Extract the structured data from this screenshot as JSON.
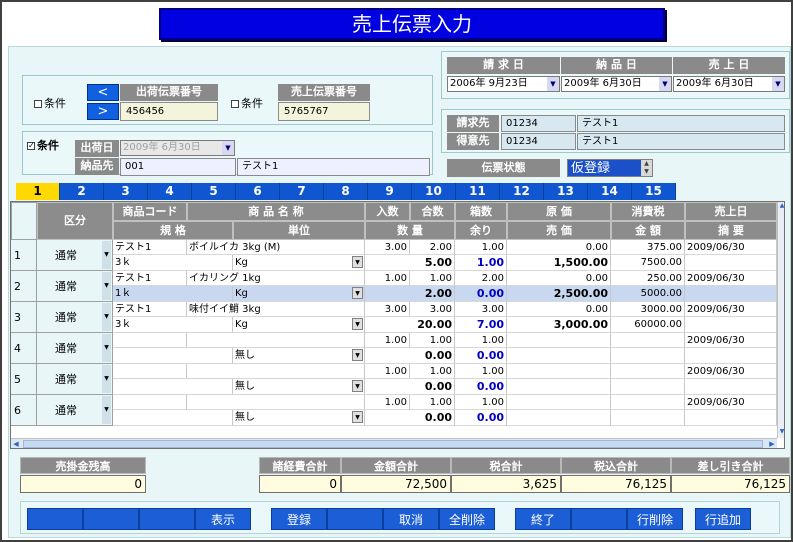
{
  "title": "売上伝票入力",
  "left_top": {
    "cond1_label": "条件",
    "prev_btn": "<",
    "next_btn": ">",
    "shipping_no_label": "出荷伝票番号",
    "shipping_no": "456456",
    "cond2_label": "条件",
    "sales_no_label": "売上伝票番号",
    "sales_no": "5765767"
  },
  "left_mid": {
    "cond_checked_mark": "✓",
    "cond_label": "条件",
    "ship_date_label": "出荷日",
    "ship_date": "2009年 6月30日",
    "dest_label": "納品先",
    "dest_code": "001",
    "dest_name": "テスト1"
  },
  "dates": {
    "billing_date_label": "請 求 日",
    "delivery_date_label": "納 品 日",
    "sales_date_label": "売 上 日",
    "billing_date": "2006年 9月23日",
    "delivery_date": "2009年 6月30日",
    "sales_date": "2009年 6月30日"
  },
  "customer": {
    "bill_to_label": "請求先",
    "bill_to_code": "01234",
    "bill_to_name": "テスト1",
    "client_label": "得意先",
    "client_code": "01234",
    "client_name": "テスト1"
  },
  "status": {
    "label": "伝票状態",
    "value": "仮登録"
  },
  "pages": [
    "1",
    "2",
    "3",
    "4",
    "5",
    "6",
    "7",
    "8",
    "9",
    "10",
    "11",
    "12",
    "13",
    "14",
    "15"
  ],
  "headers": {
    "kubun": "区分",
    "code": "商品コード",
    "name": "商 品 名 称",
    "irisu": "入数",
    "gosu": "合数",
    "hakosu": "箱数",
    "genka": "原 価",
    "tax": "消費税",
    "uriage_date": "売上日",
    "kikaku": "規 格",
    "tani": "単位",
    "suryo": "数 量",
    "amari": "余り",
    "baika": "売 価",
    "kingaku": "金 額",
    "tekiyo": "摘 要"
  },
  "rows": [
    {
      "num": "1",
      "kubun": "通常",
      "code": "テスト1",
      "name": "ボイルイカ 3kg (M)",
      "irisu": "3.00",
      "gosu": "2.00",
      "hakosu": "1.00",
      "genka": "0.00",
      "tax": "375.00",
      "date": "2009/06/30",
      "kikaku": "3ｋ",
      "tani": "Kg",
      "suryo": "5.00",
      "amari": "1.00",
      "baika": "1,500.00",
      "kingaku": "7500.00",
      "tekiyo": ""
    },
    {
      "num": "2",
      "kubun": "通常",
      "code": "テスト1",
      "name": "イカリング 1kg",
      "irisu": "1.00",
      "gosu": "1.00",
      "hakosu": "2.00",
      "genka": "0.00",
      "tax": "250.00",
      "date": "2009/06/30",
      "kikaku": "1ｋ",
      "tani": "Kg",
      "suryo": "2.00",
      "amari": "0.00",
      "baika": "2,500.00",
      "kingaku": "5000.00",
      "tekiyo": ""
    },
    {
      "num": "3",
      "kubun": "通常",
      "code": "テスト1",
      "name": "味付イイ鮹 3kg",
      "irisu": "3.00",
      "gosu": "3.00",
      "hakosu": "3.00",
      "genka": "0.00",
      "tax": "3000.00",
      "date": "2009/06/30",
      "kikaku": "3ｋ",
      "tani": "Kg",
      "suryo": "20.00",
      "amari": "7.00",
      "baika": "3,000.00",
      "kingaku": "60000.00",
      "tekiyo": ""
    },
    {
      "num": "4",
      "kubun": "通常",
      "code": "",
      "name": "",
      "irisu": "1.00",
      "gosu": "1.00",
      "hakosu": "1.00",
      "genka": "",
      "tax": "",
      "date": "2009/06/30",
      "kikaku": "",
      "tani": "無し",
      "suryo": "0.00",
      "amari": "0.00",
      "baika": "",
      "kingaku": "",
      "tekiyo": ""
    },
    {
      "num": "5",
      "kubun": "通常",
      "code": "",
      "name": "",
      "irisu": "1.00",
      "gosu": "1.00",
      "hakosu": "1.00",
      "genka": "",
      "tax": "",
      "date": "2009/06/30",
      "kikaku": "",
      "tani": "無し",
      "suryo": "0.00",
      "amari": "0.00",
      "baika": "",
      "kingaku": "",
      "tekiyo": ""
    },
    {
      "num": "6",
      "kubun": "通常",
      "code": "",
      "name": "",
      "irisu": "1.00",
      "gosu": "1.00",
      "hakosu": "1.00",
      "genka": "",
      "tax": "",
      "date": "2009/06/30",
      "kikaku": "",
      "tani": "無し",
      "suryo": "0.00",
      "amari": "0.00",
      "baika": "",
      "kingaku": "",
      "tekiyo": ""
    }
  ],
  "totals": {
    "receivable_label": "売掛金残高",
    "receivable": "0",
    "expenses_label": "諸経費合計",
    "expenses": "0",
    "amount_label": "金額合計",
    "amount": "72,500",
    "tax_label": "税合計",
    "tax": "3,625",
    "with_tax_label": "税込合計",
    "with_tax": "76,125",
    "net_label": "差し引き合計",
    "net": "76,125"
  },
  "buttons": {
    "f1": "",
    "f2": "",
    "f3": "",
    "display": "表示",
    "register": "登録",
    "f6": "",
    "cancel": "取消",
    "delete_all": "全削除",
    "end": "終了",
    "f10": "",
    "delete_row": "行削除",
    "add_row": "行追加"
  },
  "colors": {
    "accent": "#1c5ed6",
    "title_bg": "#0000e0",
    "active_tab": "#ffd800",
    "label_gray": "#8a8a8a"
  }
}
